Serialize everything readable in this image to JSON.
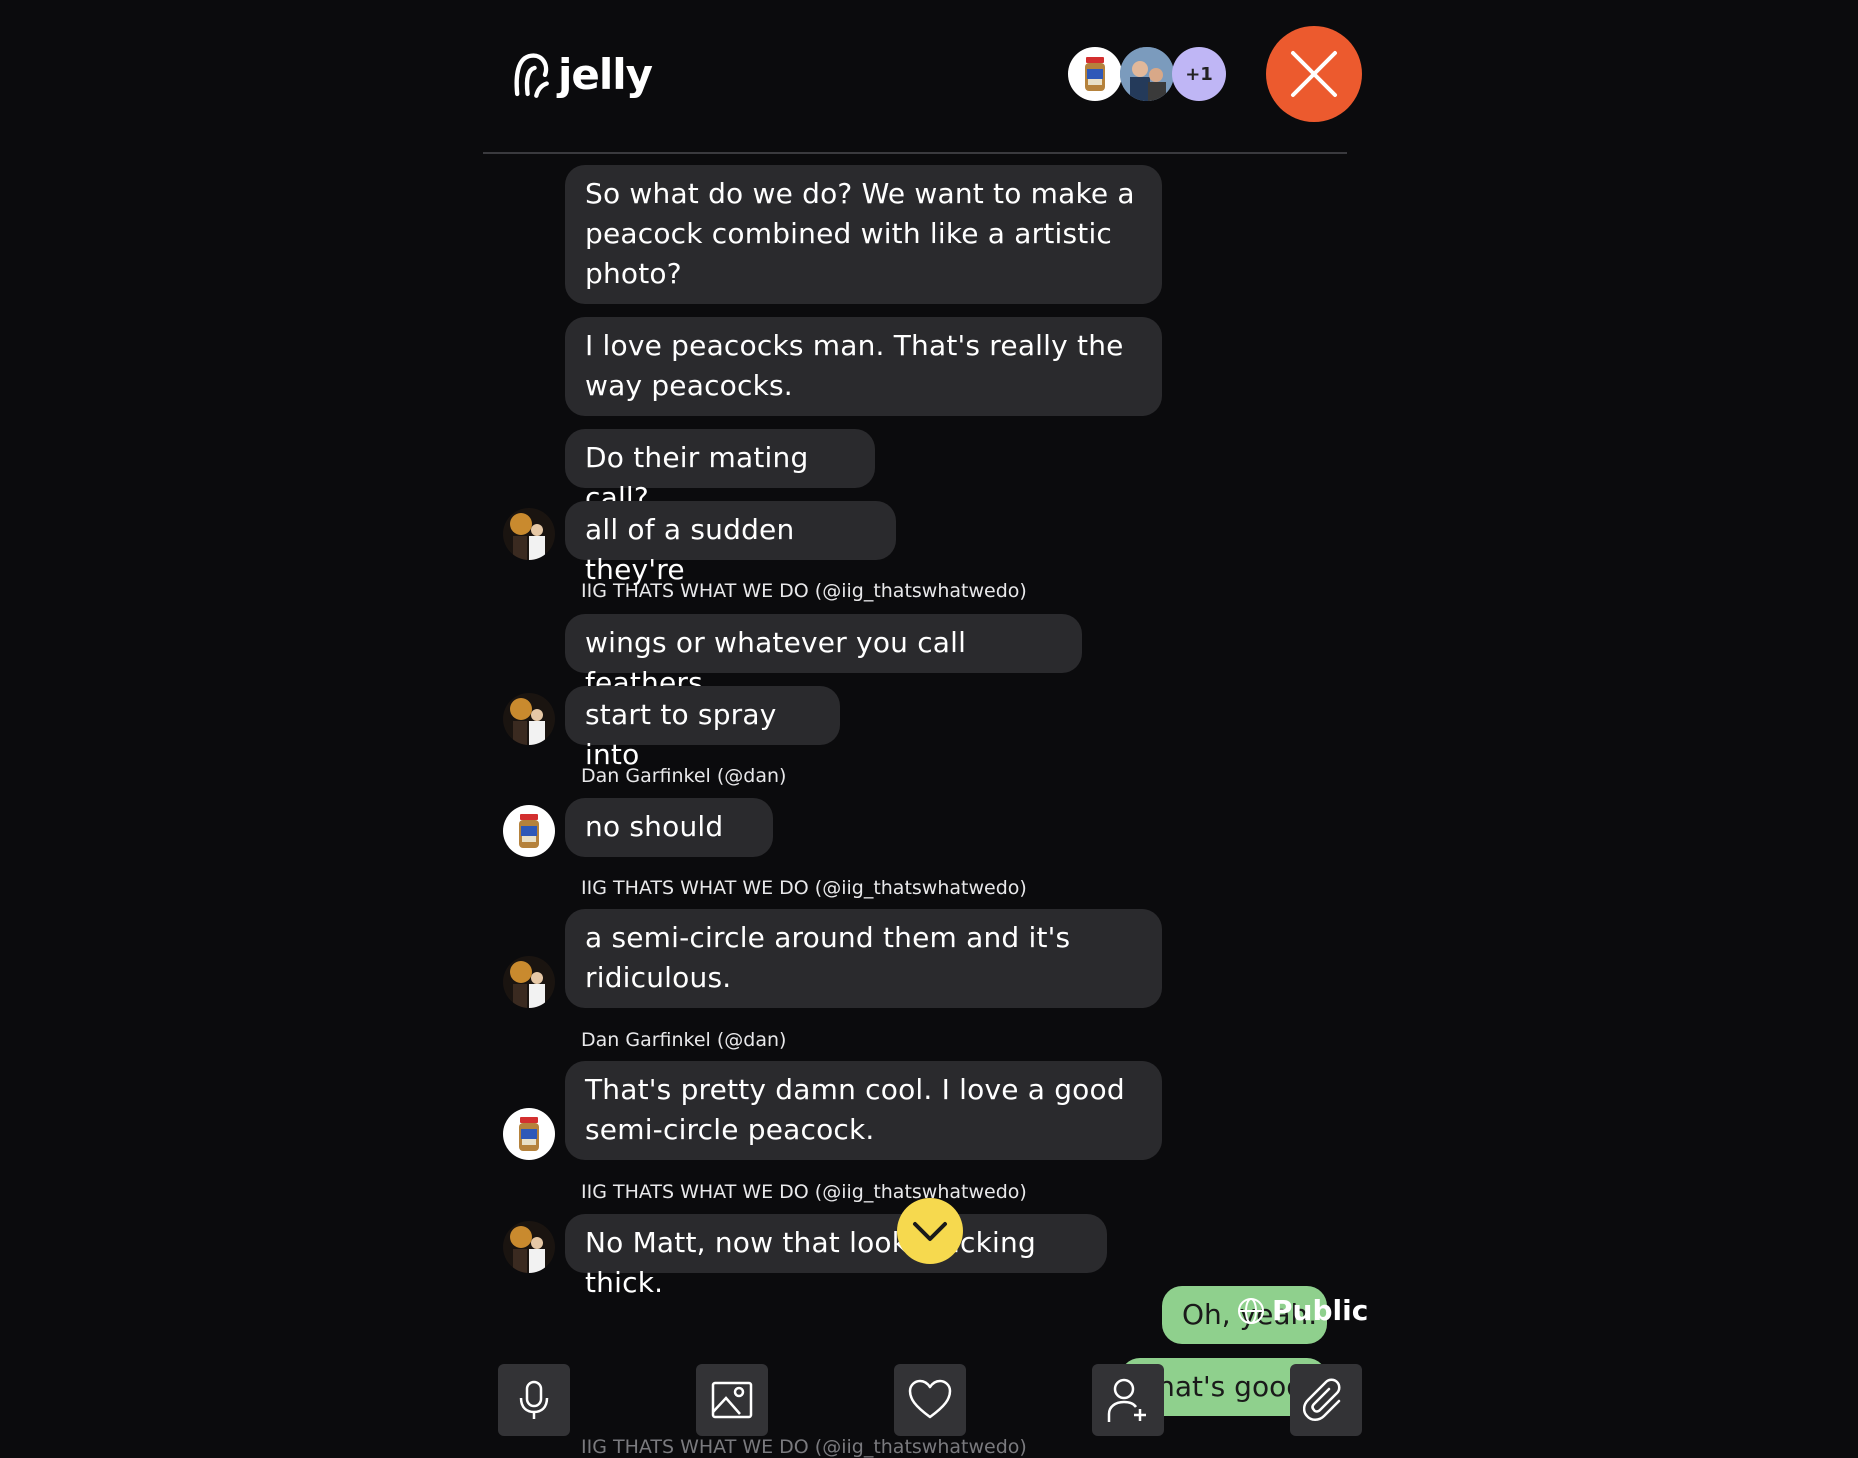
{
  "header": {
    "logo_text": "jelly",
    "participants_extra": "+1"
  },
  "messages": [
    {
      "text": "So what do we do? We want to make a peacock combined with like a artistic photo?"
    },
    {
      "text": "I love peacocks man. That's really the way peacocks."
    },
    {
      "text": "Do their mating call?"
    },
    {
      "text": "all of a sudden they're"
    },
    {
      "sender": "IIG THATS WHAT WE DO (@iig_thatswhatwedo)",
      "text": "wings or whatever you call feathers."
    },
    {
      "text": "start to spray into"
    },
    {
      "sender": "Dan Garfinkel (@dan)",
      "text": "no should"
    },
    {
      "sender": "IIG THATS WHAT WE DO (@iig_thatswhatwedo)",
      "text": "a semi-circle around them and it's ridiculous."
    },
    {
      "sender": "Dan Garfinkel (@dan)",
      "text": "That's pretty damn cool. I love a good semi-circle peacock."
    },
    {
      "sender": "IIG THATS WHAT WE DO (@iig_thatswhatwedo)",
      "text": "No Matt, now that looks fucking thick."
    }
  ],
  "my_messages": [
    {
      "text": "Oh, yeah."
    },
    {
      "text": "That's good"
    }
  ],
  "visibility": {
    "label": "Public",
    "icon": "globe-icon"
  },
  "toolbar": {
    "icons": [
      "microphone-icon",
      "image-icon",
      "heart-icon",
      "add-user-icon",
      "paperclip-icon"
    ]
  },
  "partial_sender": "IIG THATS WHAT WE DO (@iig_thatswhatwedo)",
  "colors": {
    "background": "#0b0b0d",
    "bubble": "#2a2a2d",
    "my_bubble": "#8fd08d",
    "close_button": "#ec5a2e",
    "scroll_button": "#f6d94e",
    "plus_badge": "#bfb6f5"
  }
}
